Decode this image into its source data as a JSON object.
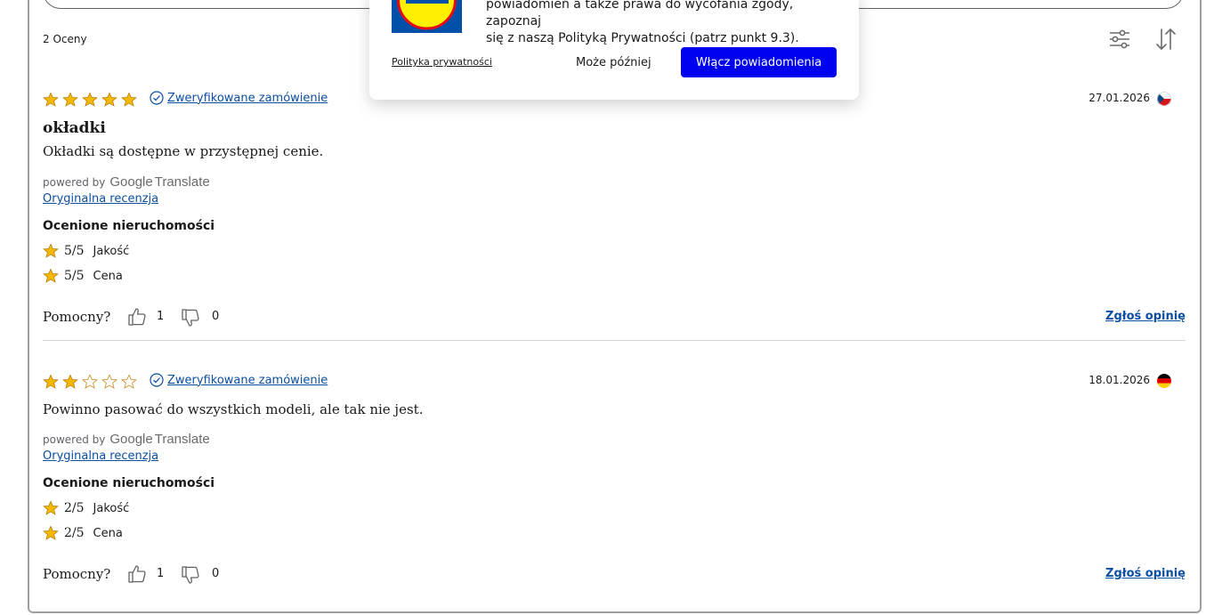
{
  "reviews_header": {
    "count_label": "2 Oceny",
    "filter_icon": "sliders-icon",
    "sort_icon": "sort-arrows-icon"
  },
  "colors": {
    "star_gold": "#f5b800",
    "link_blue": "#0b4ea2",
    "button_blue": "#0000f0"
  },
  "reviews": [
    {
      "rating": 5,
      "verified_label": "Zweryfikowane zamówienie",
      "date": "27.01.2026",
      "country_flag": "czech-flag-icon",
      "title": "okładki",
      "text": "Okładki są dostępne w przystępnej cenie.",
      "powered_by": "powered by",
      "google": "Google",
      "translate": "Translate",
      "original_link": "Oryginalna recenzja",
      "properties_title": "Ocenione nieruchomości",
      "properties": [
        {
          "score": "5/5",
          "name": "Jakość"
        },
        {
          "score": "5/5",
          "name": "Cena"
        }
      ],
      "helpful_label": "Pomocny?",
      "thumbs_up": "1",
      "thumbs_down": "0",
      "report_label": "Zgłoś opinię"
    },
    {
      "rating": 2,
      "verified_label": "Zweryfikowane zamówienie",
      "date": "18.01.2026",
      "country_flag": "germany-flag-icon",
      "title": "",
      "text": "Powinno pasować do wszystkich modeli, ale tak nie jest.",
      "powered_by": "powered by",
      "google": "Google",
      "translate": "Translate",
      "original_link": "Oryginalna recenzja",
      "properties_title": "Ocenione nieruchomości",
      "properties": [
        {
          "score": "2/5",
          "name": "Jakość"
        },
        {
          "score": "2/5",
          "name": "Cena"
        }
      ],
      "helpful_label": "Pomocny?",
      "thumbs_up": "1",
      "thumbs_down": "0",
      "report_label": "Zgłoś opinię"
    }
  ],
  "popup": {
    "logo": "lidl-logo",
    "text_line1": "powiadomień a także prawa do wycofania zgody, zapoznaj",
    "text_line2": "się z naszą Polityką Prywatności (patrz punkt 9.3).",
    "privacy_link": "Polityka prywatności",
    "later_button": "Może później",
    "enable_button": "Włącz powiadomienia"
  }
}
